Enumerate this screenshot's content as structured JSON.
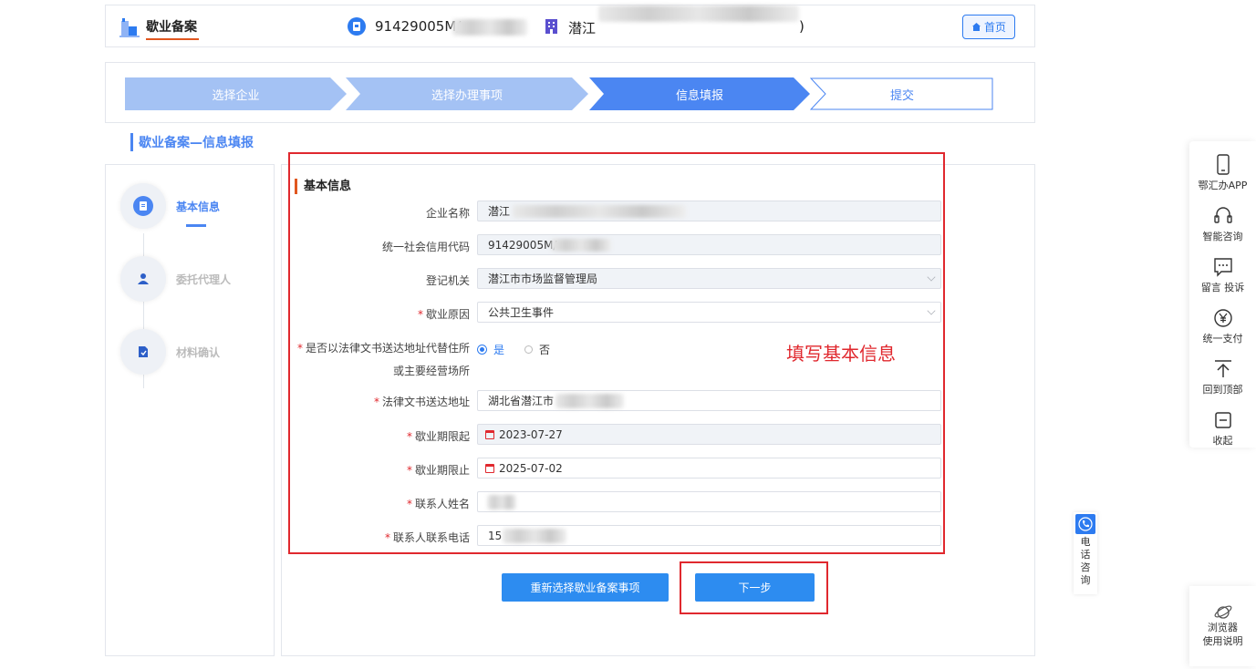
{
  "header": {
    "page_label": "歇业备案",
    "credit_code": "91429005M/",
    "company_name": "潜江",
    "company_suffix": ")",
    "home_label": "首页"
  },
  "steps": [
    {
      "label": "选择企业",
      "state": "done"
    },
    {
      "label": "选择办理事项",
      "state": "done"
    },
    {
      "label": "信息填报",
      "state": "active"
    },
    {
      "label": "提交",
      "state": "todo"
    }
  ],
  "section_title": "歇业备案—信息填报",
  "left_nav": [
    {
      "label": "基本信息",
      "icon": "document-icon",
      "active": true
    },
    {
      "label": "委托代理人",
      "icon": "person-icon",
      "active": false
    },
    {
      "label": "材料确认",
      "icon": "file-check-icon",
      "active": false
    }
  ],
  "form": {
    "section": "基本信息",
    "fields": {
      "company_name": {
        "label": "企业名称",
        "value": "潜江"
      },
      "credit_code": {
        "label": "统一社会信用代码",
        "value": "91429005M/"
      },
      "authority": {
        "label": "登记机关",
        "value": "潜江市市场监督管理局"
      },
      "reason": {
        "label": "歇业原因",
        "value": "公共卫生事件"
      },
      "replace_address": {
        "label_line1": "是否以法律文书送达地址代替住所",
        "label_line2": "或主要经营场所",
        "yes": "是",
        "no": "否",
        "selected": "是"
      },
      "legal_address": {
        "label": "法律文书送达地址",
        "value": "湖北省潜江市"
      },
      "start_date": {
        "label": "歇业期限起",
        "value": "2023-07-27"
      },
      "end_date": {
        "label": "歇业期限止",
        "value": "2025-07-02"
      },
      "contact_name": {
        "label": "联系人姓名",
        "value": ""
      },
      "contact_phone": {
        "label": "联系人联系电话",
        "value": "15"
      }
    }
  },
  "annotation": "填写基本信息",
  "buttons": {
    "reselect": "重新选择歇业备案事项",
    "next": "下一步"
  },
  "sidebar": [
    {
      "label": "鄂汇办APP",
      "icon": "phone-icon"
    },
    {
      "label": "智能咨询",
      "icon": "headset-icon"
    },
    {
      "label": "留言 投诉",
      "icon": "message-icon"
    },
    {
      "label": "统一支付",
      "icon": "yuan-icon"
    },
    {
      "label": "回到顶部",
      "icon": "arrow-up-icon"
    },
    {
      "label": "收起",
      "icon": "collapse-icon"
    }
  ],
  "phone_tab": "电话咨询",
  "browser_card": {
    "line1": "浏览器",
    "line2": "使用说明"
  },
  "colors": {
    "primary": "#2d7bf0",
    "step_done": "#a4c2f4",
    "step_active": "#4b86f2",
    "accent_red": "#e0282e",
    "orange": "#e0561f"
  }
}
